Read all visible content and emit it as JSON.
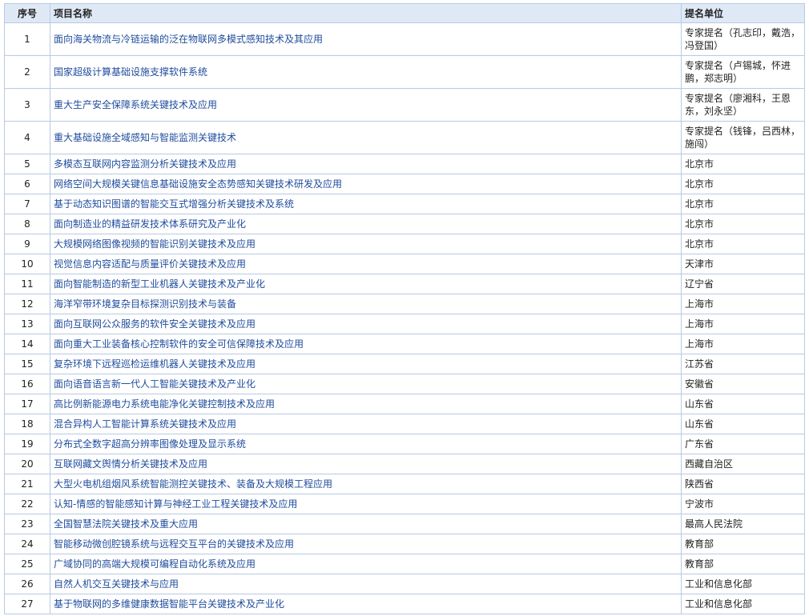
{
  "colors": {
    "header_bg": "#dfe9f5",
    "border": "#b7cbe3",
    "link": "#1f4c9c",
    "text": "#222222"
  },
  "table": {
    "headers": {
      "no": "序号",
      "name": "项目名称",
      "nominator": "提名单位"
    },
    "rows": [
      {
        "no": "1",
        "name": "面向海关物流与冷链运输的泛在物联网多模式感知技术及其应用",
        "nominator": "专家提名（孔志印，戴浩，冯登国）"
      },
      {
        "no": "2",
        "name": "国家超级计算基础设施支撑软件系统",
        "nominator": "专家提名（卢锡城，怀进鹏，郑志明）"
      },
      {
        "no": "3",
        "name": "重大生产安全保障系统关键技术及应用",
        "nominator": "专家提名（廖湘科，王恩东，刘永坚）"
      },
      {
        "no": "4",
        "name": "重大基础设施全域感知与智能监测关键技术",
        "nominator": "专家提名（钱锋，吕西林，施闯）"
      },
      {
        "no": "5",
        "name": "多模态互联网内容监测分析关键技术及应用",
        "nominator": "北京市"
      },
      {
        "no": "6",
        "name": "网络空间大规模关键信息基础设施安全态势感知关键技术研发及应用",
        "nominator": "北京市"
      },
      {
        "no": "7",
        "name": "基于动态知识图谱的智能交互式增强分析关键技术及系统",
        "nominator": "北京市"
      },
      {
        "no": "8",
        "name": "面向制造业的精益研发技术体系研究及产业化",
        "nominator": "北京市"
      },
      {
        "no": "9",
        "name": "大规模网络图像视频的智能识别关键技术及应用",
        "nominator": "北京市"
      },
      {
        "no": "10",
        "name": "视觉信息内容适配与质量评价关键技术及应用",
        "nominator": "天津市"
      },
      {
        "no": "11",
        "name": "面向智能制造的新型工业机器人关键技术及产业化",
        "nominator": "辽宁省"
      },
      {
        "no": "12",
        "name": "海洋窄带环境复杂目标探测识别技术与装备",
        "nominator": "上海市"
      },
      {
        "no": "13",
        "name": "面向互联网公众服务的软件安全关键技术及应用",
        "nominator": "上海市"
      },
      {
        "no": "14",
        "name": "面向重大工业装备核心控制软件的安全可信保障技术及应用",
        "nominator": "上海市"
      },
      {
        "no": "15",
        "name": "复杂环境下远程巡检运维机器人关键技术及应用",
        "nominator": "江苏省"
      },
      {
        "no": "16",
        "name": "面向语音语言新一代人工智能关键技术及产业化",
        "nominator": "安徽省"
      },
      {
        "no": "17",
        "name": "高比例新能源电力系统电能净化关键控制技术及应用",
        "nominator": "山东省"
      },
      {
        "no": "18",
        "name": "混合异构人工智能计算系统关键技术及应用",
        "nominator": "山东省"
      },
      {
        "no": "19",
        "name": "分布式全数字超高分辨率图像处理及显示系统",
        "nominator": "广东省"
      },
      {
        "no": "20",
        "name": "互联网藏文舆情分析关键技术及应用",
        "nominator": "西藏自治区"
      },
      {
        "no": "21",
        "name": "大型火电机组烟风系统智能测控关键技术、装备及大规模工程应用",
        "nominator": "陕西省"
      },
      {
        "no": "22",
        "name": "认知-情感的智能感知计算与神经工业工程关键技术及应用",
        "nominator": "宁波市"
      },
      {
        "no": "23",
        "name": "全国智慧法院关键技术及重大应用",
        "nominator": "最高人民法院"
      },
      {
        "no": "24",
        "name": "智能移动微创腔镜系统与远程交互平台的关键技术及应用",
        "nominator": "教育部"
      },
      {
        "no": "25",
        "name": "广域协同的高端大规模可编程自动化系统及应用",
        "nominator": "教育部"
      },
      {
        "no": "26",
        "name": "自然人机交互关键技术与应用",
        "nominator": "工业和信息化部"
      },
      {
        "no": "27",
        "name": "基于物联网的多维健康数据智能平台关键技术及产业化",
        "nominator": "工业和信息化部"
      }
    ]
  }
}
